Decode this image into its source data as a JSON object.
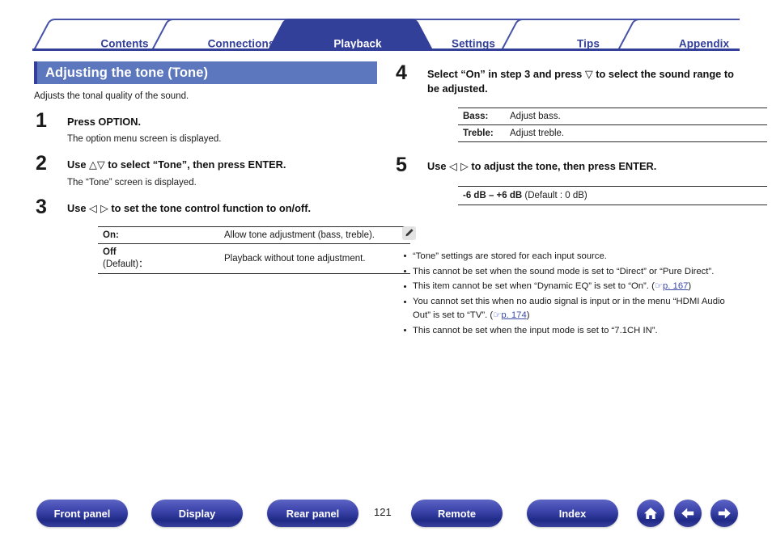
{
  "tabs": [
    {
      "label": "Contents",
      "active": false
    },
    {
      "label": "Connections",
      "active": false
    },
    {
      "label": "Playback",
      "active": true
    },
    {
      "label": "Settings",
      "active": false
    },
    {
      "label": "Tips",
      "active": false
    },
    {
      "label": "Appendix",
      "active": false
    }
  ],
  "colors": {
    "tab_active_bg": "#33409a",
    "tab_text": "#33409a",
    "title_banner_bg": "#5c77bd",
    "title_accent": "#33409a",
    "link": "#3a49a8",
    "button_gradient_top": "#5b63c4",
    "button_gradient_bottom": "#1f2a86"
  },
  "title": "Adjusting the tone (Tone)",
  "intro": "Adjusts the tonal quality of the sound.",
  "steps": [
    {
      "num": "1",
      "title": "Press OPTION.",
      "sub": "The option menu screen is displayed."
    },
    {
      "num": "2",
      "title_pre": "Use ",
      "glyph": "△▽",
      "title_post": " to select “Tone”, then press ENTER.",
      "sub": "The “Tone” screen is displayed."
    },
    {
      "num": "3",
      "title_pre": "Use ",
      "glyph": "◁ ▷",
      "title_post": " to set the tone control function to on/off."
    },
    {
      "num": "4",
      "title_pre": "Select “On” in step 3 and press ",
      "glyph": "▽",
      "title_post": " to select the sound range to be adjusted."
    },
    {
      "num": "5",
      "title_pre": "Use ",
      "glyph": "◁ ▷",
      "title_post": " to adjust the tone, then press ENTER."
    }
  ],
  "table_onoff": {
    "rows": [
      {
        "key": "On:",
        "key_soft": "",
        "value": "Allow tone adjustment (bass, treble)."
      },
      {
        "key": "Off",
        "key_soft": "(Default)：",
        "value": "Playback without tone adjustment."
      }
    ]
  },
  "table_range": {
    "rows": [
      {
        "key": "Bass:",
        "value": "Adjust bass."
      },
      {
        "key": "Treble:",
        "value": "Adjust treble."
      }
    ]
  },
  "table_db": {
    "bold": "-6 dB – +6 dB",
    "normal": " (Default : 0 dB)"
  },
  "note": {
    "icon": "pencil-icon",
    "bullets": [
      {
        "text": "“Tone” settings are stored for each input source."
      },
      {
        "text": "This cannot be set when the sound mode is set to “Direct” or “Pure Direct”."
      },
      {
        "text": "This item cannot be set when “Dynamic EQ” is set to “On”.  (",
        "link": "p. 167",
        "text_after": ")"
      },
      {
        "text": "You cannot set this when no audio signal is input or in the menu “HDMI Audio Out” is set to “TV”.  (",
        "link": "p. 174",
        "text_after": ")"
      },
      {
        "text": "This cannot be set when the input mode is set to “7.1CH IN”."
      }
    ]
  },
  "footer": {
    "buttons": [
      {
        "label": "Front panel"
      },
      {
        "label": "Display"
      },
      {
        "label": "Rear panel"
      },
      {
        "label": "Remote"
      },
      {
        "label": "Index"
      }
    ],
    "page_number": "121",
    "icons": [
      {
        "name": "home-icon"
      },
      {
        "name": "arrow-left-icon"
      },
      {
        "name": "arrow-right-icon"
      }
    ]
  }
}
